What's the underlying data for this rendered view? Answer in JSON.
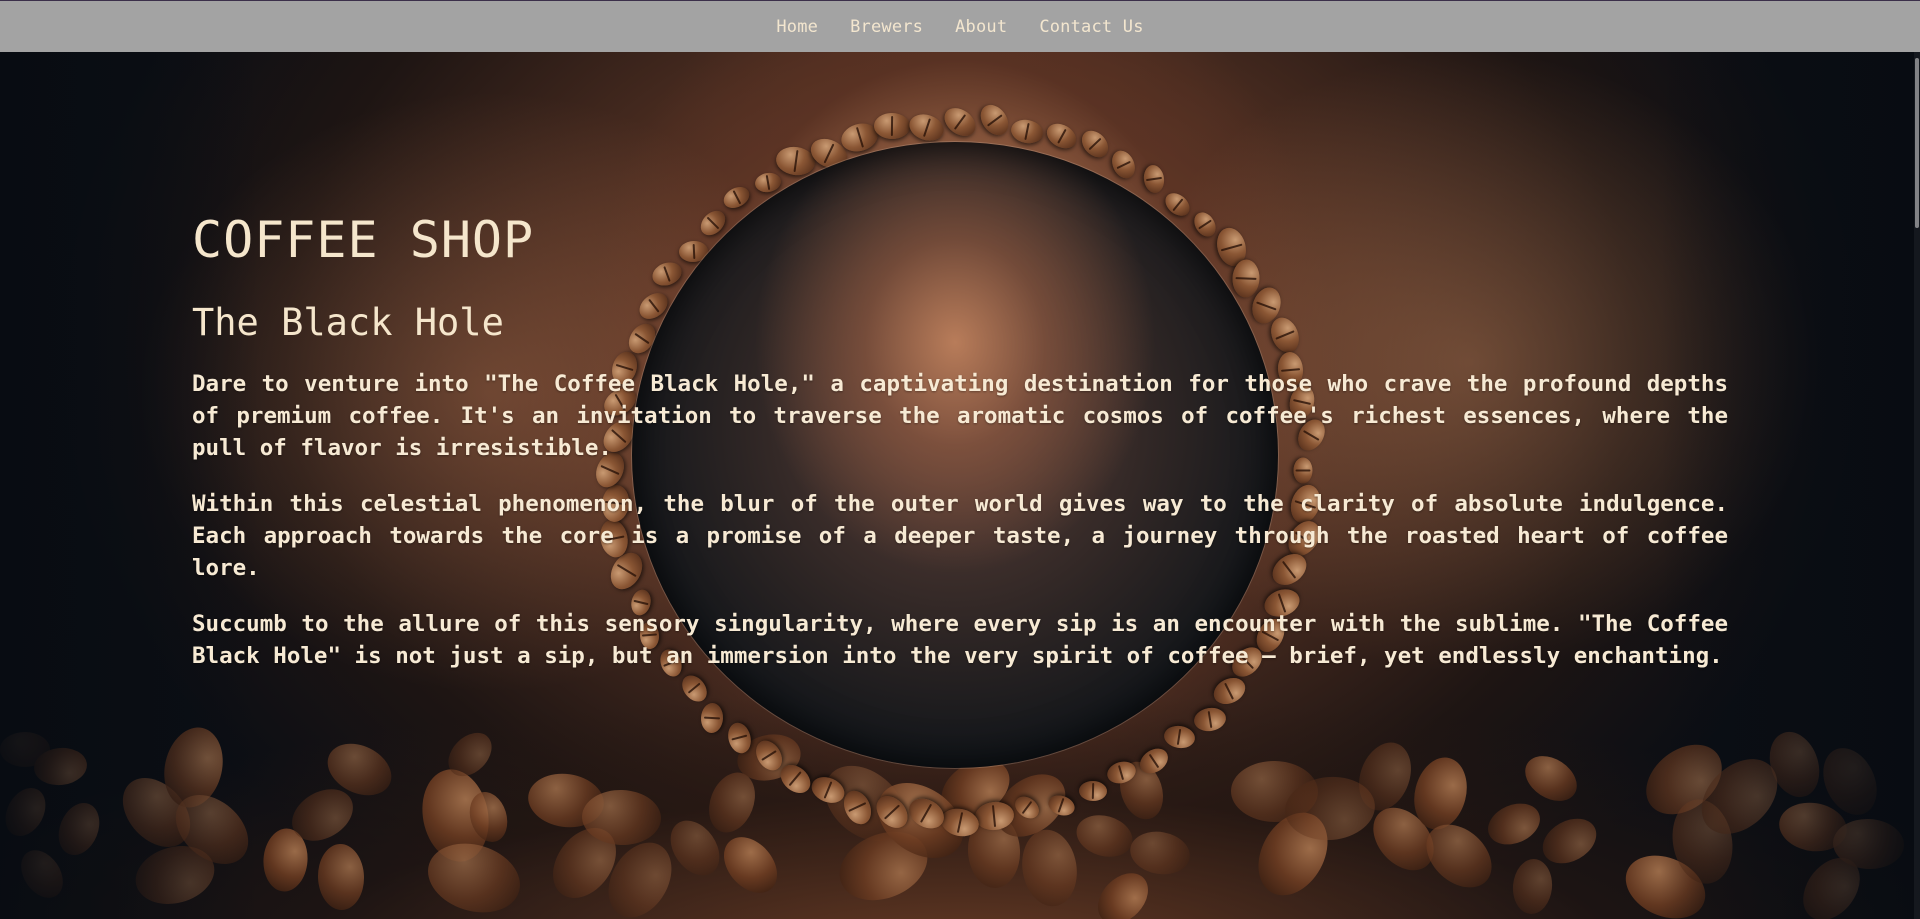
{
  "nav": {
    "items": [
      {
        "label": "Home"
      },
      {
        "label": "Brewers"
      },
      {
        "label": "About"
      },
      {
        "label": "Contact Us"
      }
    ]
  },
  "hero": {
    "title": "COFFEE SHOP",
    "subtitle": "The Black Hole",
    "paragraphs": [
      "Dare to venture into \"The Coffee Black Hole,\" a captivating destination for those who crave the profound depths of premium coffee. It's an invitation to traverse the aromatic cosmos of coffee's richest essences, where the pull of flavor is irresistible.",
      "Within this celestial phenomenon, the blur of the outer world gives way to the clarity of absolute indulgence. Each approach towards the core is a promise of a deeper taste, a journey through the roasted heart of coffee lore.",
      "Succumb to the allure of this sensory singularity, where every sip is an encounter with the sublime. \"The Coffee Black Hole\" is not just a sip, but an immersion into the very spirit of coffee – brief, yet endlessly enchanting."
    ]
  },
  "colors": {
    "navbar_bg": "#a3a3a3",
    "text": "#f5e6cc",
    "background_dark": "#0b0e14",
    "coffee_brown": "#7a4a33"
  }
}
